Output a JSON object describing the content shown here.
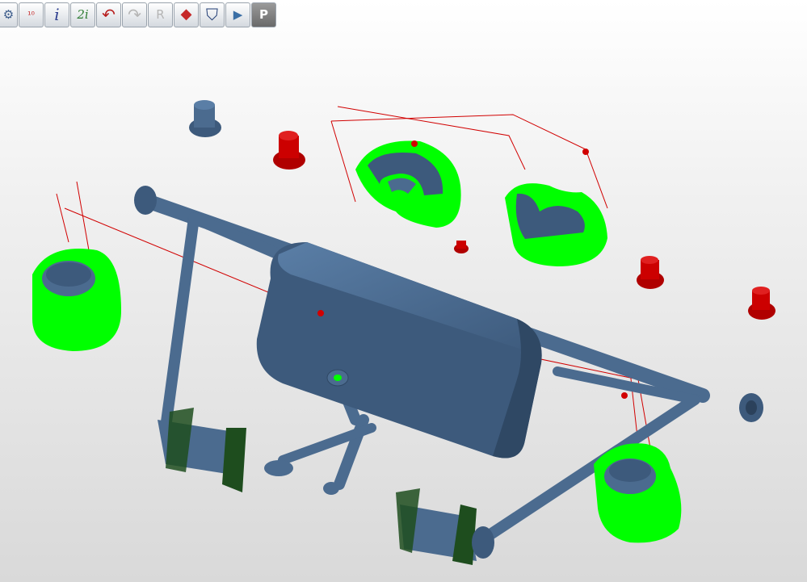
{
  "toolbar": {
    "buttons": [
      {
        "name": "settings-gear-icon",
        "glyph": "⚙",
        "color": "#3a5a8a"
      },
      {
        "name": "iterations-10-icon",
        "glyph": "¹⁰",
        "color": "#c62828"
      },
      {
        "name": "part-info-icon",
        "glyph": "i",
        "color": "#2e3f8f"
      },
      {
        "name": "compare-info-icon",
        "glyph": "2i",
        "color": "#2e7d32"
      },
      {
        "name": "undo-icon",
        "glyph": "↶",
        "color": "#b71c1c"
      },
      {
        "name": "redo-icon",
        "glyph": "↷",
        "color": "#9e9e9e"
      },
      {
        "name": "filter-r-icon",
        "glyph": "R",
        "color": "#9e9e9e"
      },
      {
        "name": "box-view-icon",
        "glyph": "◆",
        "color": "#c62828"
      },
      {
        "name": "shield-icon",
        "glyph": "⛉",
        "color": "#1f3b73"
      },
      {
        "name": "transform-icon",
        "glyph": "▶",
        "color": "#3a6ea5"
      },
      {
        "name": "parking-p-icon",
        "glyph": "P",
        "color": "#666666"
      }
    ]
  },
  "scene": {
    "colors": {
      "part": "#4b6b8f",
      "part_dark": "#2f4864",
      "highlight": "#00ff00",
      "fixture": "#cc0000",
      "guide_line": "#d10000",
      "pad": "#1e4d1e"
    }
  }
}
